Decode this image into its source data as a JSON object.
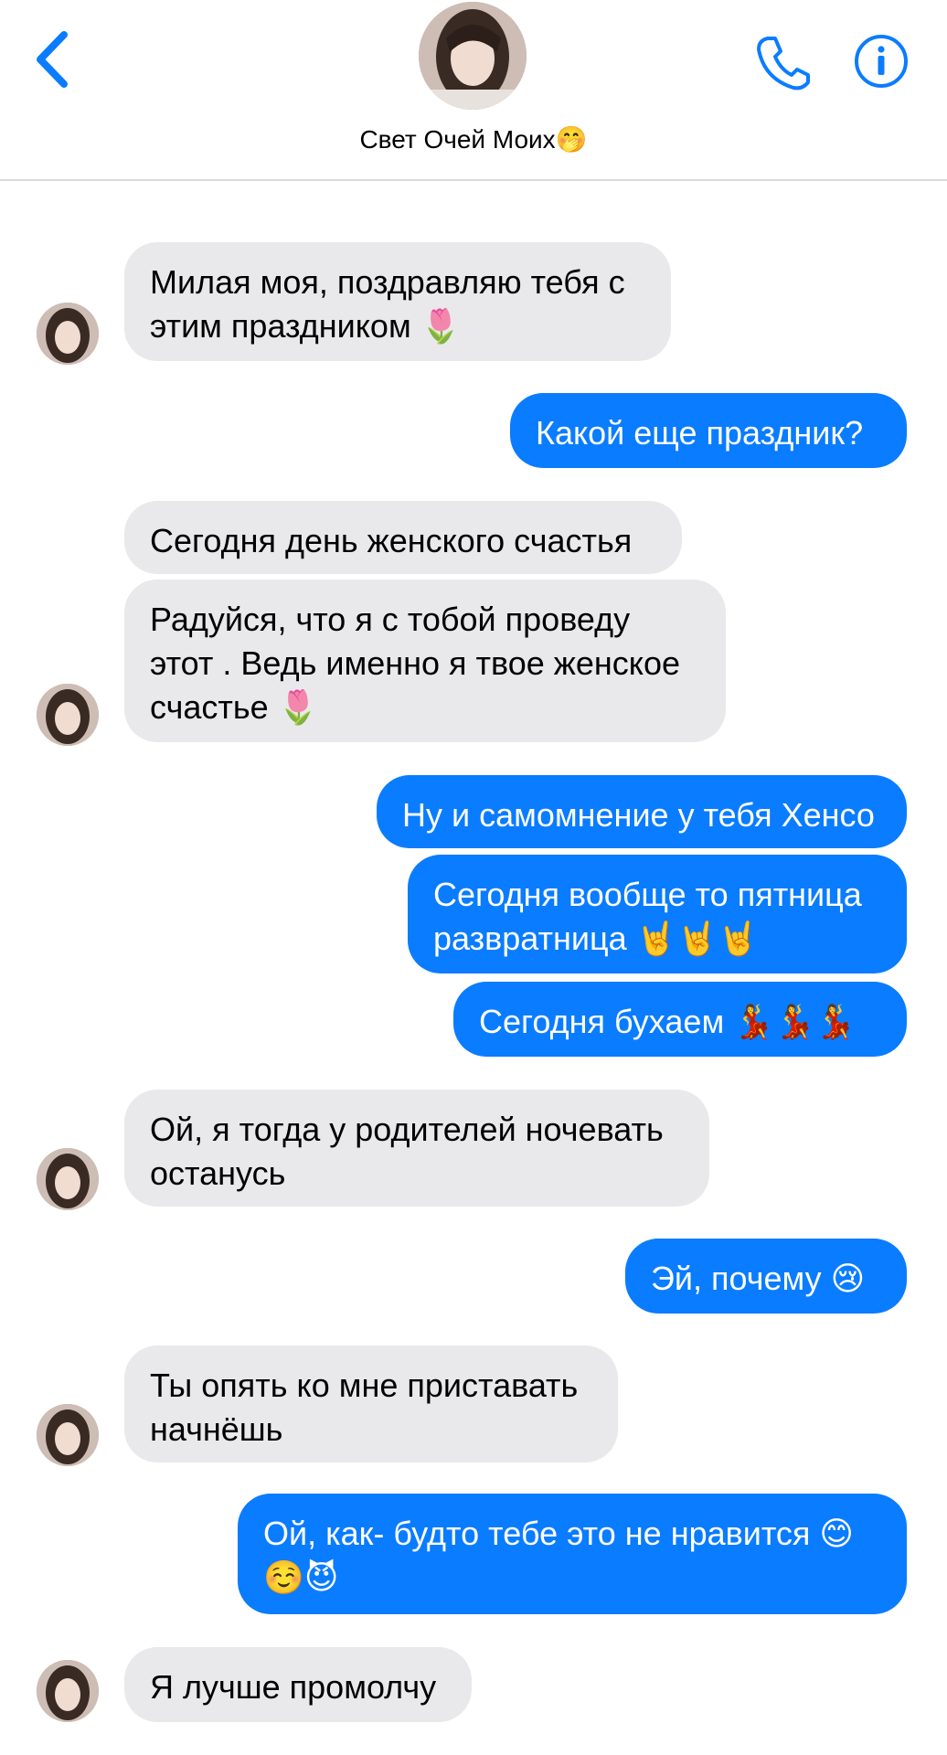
{
  "header": {
    "contact_name": "Свет Очей Моих🤭"
  },
  "messages": [
    {
      "from": "them",
      "text": "Милая моя, поздравляю тебя с\nэтим праздником 🌷"
    },
    {
      "from": "me",
      "text": "Какой еще праздник?"
    },
    {
      "from": "them",
      "text": "Сегодня день женского счастья"
    },
    {
      "from": "them",
      "text": "Радуйся, что я с тобой проведу\nэтот . Ведь именно я твое женское\nсчастье 🌷"
    },
    {
      "from": "me",
      "text": "Ну и самомнение у тебя Хенсо"
    },
    {
      "from": "me",
      "text": "Сегодня вообще то пятница\nразвратница 🤘🤘🤘"
    },
    {
      "from": "me",
      "text": "Сегодня бухаем 💃💃💃"
    },
    {
      "from": "them",
      "text": "Ой, я тогда у родителей ночевать\nостанусь"
    },
    {
      "from": "me",
      "text": "Эй, почему 😢"
    },
    {
      "from": "them",
      "text": "Ты опять ко мне приставать\nначнёшь"
    },
    {
      "from": "me",
      "text": "Ой, как- будто тебе это не нравится 😊\n☺️😈"
    },
    {
      "from": "them",
      "text": "Я лучше промолчу"
    }
  ],
  "colors": {
    "accent": "#0a7cff",
    "incoming_bubble": "#e9e9eb"
  }
}
